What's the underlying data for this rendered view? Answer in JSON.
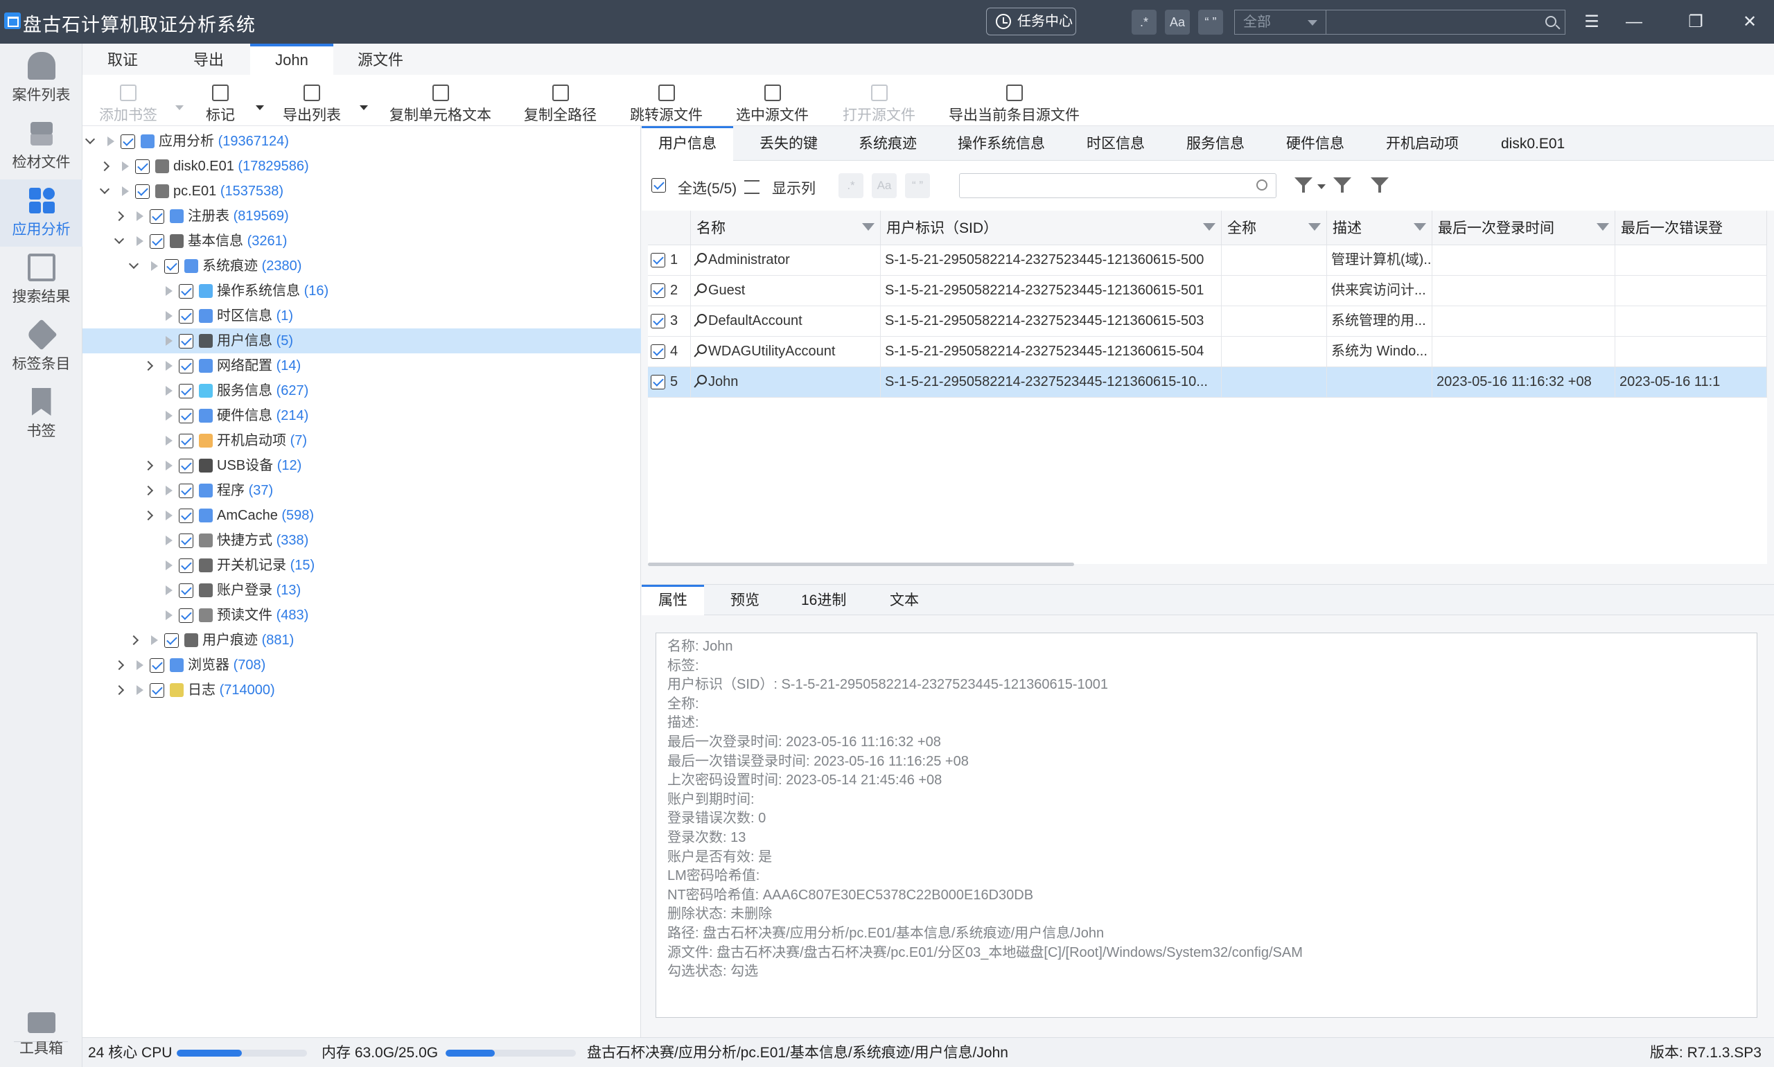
{
  "app": {
    "title": "盘古石计算机取证分析系统"
  },
  "titlebar": {
    "task_center": "任务中心",
    "regex_label": ".*",
    "case_label": "Aa",
    "quote_label": "“ ”",
    "scope_value": "全部",
    "search_value": ""
  },
  "rail": {
    "items": [
      {
        "label": "案件列表",
        "icon": "case-icon"
      },
      {
        "label": "检材文件",
        "icon": "evidence-stack-icon"
      },
      {
        "label": "应用分析",
        "icon": "apps-grid-icon"
      },
      {
        "label": "搜索结果",
        "icon": "search-doc-icon"
      },
      {
        "label": "标签条目",
        "icon": "tag-icon"
      },
      {
        "label": "书签",
        "icon": "bookmark-icon"
      }
    ],
    "toolbox": "工具箱"
  },
  "menu_tabs": [
    "取证",
    "导出",
    "John",
    "源文件"
  ],
  "ribbon": {
    "add_bookmark": "添加书签",
    "mark": "标记",
    "export_list": "导出列表",
    "copy_cell": "复制单元格文本",
    "copy_path": "复制全路径",
    "jump_source": "跳转源文件",
    "select_source": "选中源文件",
    "open_source": "打开源文件",
    "export_current": "导出当前条目源文件"
  },
  "tree": [
    {
      "label": "应用分析",
      "count": "(19367124)"
    },
    {
      "label": "disk0.E01",
      "count": "(17829586)"
    },
    {
      "label": "pc.E01",
      "count": "(1537538)"
    },
    {
      "label": "注册表",
      "count": "(819569)"
    },
    {
      "label": "基本信息",
      "count": "(3261)"
    },
    {
      "label": "系统痕迹",
      "count": "(2380)"
    },
    {
      "label": "操作系统信息",
      "count": "(16)"
    },
    {
      "label": "时区信息",
      "count": "(1)"
    },
    {
      "label": "用户信息",
      "count": "(5)"
    },
    {
      "label": "网络配置",
      "count": "(14)"
    },
    {
      "label": "服务信息",
      "count": "(627)"
    },
    {
      "label": "硬件信息",
      "count": "(214)"
    },
    {
      "label": "开机启动项",
      "count": "(7)"
    },
    {
      "label": "USB设备",
      "count": "(12)"
    },
    {
      "label": "程序",
      "count": "(37)"
    },
    {
      "label": "AmCache",
      "count": "(598)"
    },
    {
      "label": "快捷方式",
      "count": "(338)"
    },
    {
      "label": "开关机记录",
      "count": "(15)"
    },
    {
      "label": "账户登录",
      "count": "(13)"
    },
    {
      "label": "预读文件",
      "count": "(483)"
    },
    {
      "label": "用户痕迹",
      "count": "(881)"
    },
    {
      "label": "浏览器",
      "count": "(708)"
    },
    {
      "label": "日志",
      "count": "(714000)"
    }
  ],
  "right_tabs": [
    "用户信息",
    "丢失的键",
    "系统痕迹",
    "操作系统信息",
    "时区信息",
    "服务信息",
    "硬件信息",
    "开机启动项",
    "disk0.E01"
  ],
  "filter": {
    "select_all": "全选(5/5)",
    "show_columns": "显示列",
    "regex": ".*",
    "case": "Aa",
    "quote": "“ ”",
    "search_value": ""
  },
  "grid": {
    "columns": [
      "名称",
      "用户标识（SID）",
      "全称",
      "描述",
      "最后一次登录时间",
      "最后一次错误登"
    ],
    "rows": [
      {
        "num": "1",
        "name": "Administrator",
        "sid": "S-1-5-21-2950582214-2327523445-121360615-500",
        "full": "",
        "desc": "管理计算机(域)...",
        "last_login": "",
        "last_err": ""
      },
      {
        "num": "2",
        "name": "Guest",
        "sid": "S-1-5-21-2950582214-2327523445-121360615-501",
        "full": "",
        "desc": "供来宾访问计...",
        "last_login": "",
        "last_err": ""
      },
      {
        "num": "3",
        "name": "DefaultAccount",
        "sid": "S-1-5-21-2950582214-2327523445-121360615-503",
        "full": "",
        "desc": "系统管理的用...",
        "last_login": "",
        "last_err": ""
      },
      {
        "num": "4",
        "name": "WDAGUtilityAccount",
        "sid": "S-1-5-21-2950582214-2327523445-121360615-504",
        "full": "",
        "desc": "系统为 Windo...",
        "last_login": "",
        "last_err": ""
      },
      {
        "num": "5",
        "name": "John",
        "sid": "S-1-5-21-2950582214-2327523445-121360615-10...",
        "full": "",
        "desc": "",
        "last_login": "2023-05-16 11:16:32 +08",
        "last_err": "2023-05-16 11:1"
      }
    ]
  },
  "bottom_tabs": [
    "属性",
    "预览",
    "16进制",
    "文本"
  ],
  "properties": [
    "名称: John",
    "标签:",
    "用户标识（SID）: S-1-5-21-2950582214-2327523445-121360615-1001",
    "全称:",
    "描述:",
    "最后一次登录时间: 2023-05-16 11:16:32 +08",
    "最后一次错误登录时间: 2023-05-16 11:16:25 +08",
    "上次密码设置时间: 2023-05-14 21:45:46 +08",
    "账户到期时间:",
    "登录错误次数: 0",
    "登录次数: 13",
    "账户是否有效: 是",
    "LM密码哈希值:",
    "NT密码哈希值: AAA6C807E30EC5378C22B000E16D30DB",
    "删除状态: 未删除",
    "路径: 盘古石杯决赛/应用分析/pc.E01/基本信息/系统痕迹/用户信息/John",
    "源文件: 盘古石杯决赛/盘古石杯决赛/pc.E01/分区03_本地磁盘[C]/[Root]/Windows/System32/config/SAM",
    "勾选状态: 勾选"
  ],
  "status": {
    "cpu_label": "24 核心 CPU",
    "cpu_level": 0.5,
    "mem_label": "内存 63.0G/25.0G",
    "mem_level": 0.38,
    "path": "盘古石杯决赛/应用分析/pc.E01/基本信息/系统痕迹/用户信息/John",
    "version": "版本: R7.1.3.SP3"
  },
  "colors": {
    "accent": "#2d7be6",
    "titlebar": "#3c4654",
    "selection": "#cde5fb"
  }
}
